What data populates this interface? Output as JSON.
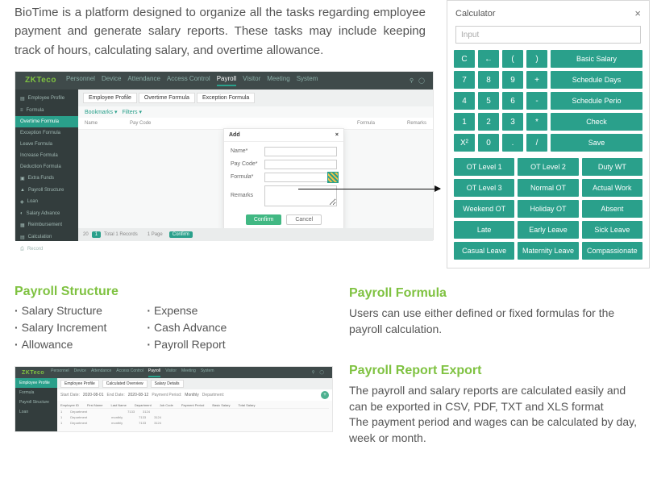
{
  "intro": "BioTime is a platform designed to organize all the tasks regarding employee payment and generate salary reports. These tasks may include keeping track of hours, calculating salary, and overtime allowance.",
  "ss1": {
    "logo": "ZKTeco",
    "nav": [
      "Personnel",
      "Device",
      "Attendance",
      "Access Control",
      "Payroll",
      "Visitor",
      "Meeting",
      "System"
    ],
    "nav_active": "Payroll",
    "tabs": [
      "Employee Profile",
      "Overtime Formula",
      "Exception Formula"
    ],
    "filters": [
      "Bookmarks ▾",
      "Filters ▾"
    ],
    "side": [
      "Employee Profile",
      "Formula",
      "Overtime Formula",
      "Exception Formula",
      "Leave Formula",
      "Increase Formula",
      "Deduction Formula",
      "Extra Funds",
      "Payroll Structure",
      "Loan",
      "Salary Advance",
      "Reimbursement",
      "Calculation",
      "Record"
    ],
    "side_active": "Overtime Formula",
    "cols": [
      "Name",
      "Pay Code",
      "Formula",
      "Remarks"
    ],
    "footer": {
      "pg": "1",
      "txt": "Total 1 Records",
      "page_lbl": "1 Page",
      "pg2": "Confirm"
    },
    "modal": {
      "title": "Add",
      "fields": {
        "name": "Name*",
        "paycode": "Pay Code*",
        "formula": "Formula*",
        "remarks": "Remarks"
      },
      "confirm": "Confirm",
      "cancel": "Cancel",
      "close": "×"
    }
  },
  "calc": {
    "title": "Calculator",
    "close": "×",
    "input_placeholder": "Input",
    "rows": [
      [
        "C",
        "←",
        "(",
        ")",
        "Basic Salary"
      ],
      [
        "7",
        "8",
        "9",
        "+",
        "Schedule Days"
      ],
      [
        "4",
        "5",
        "6",
        "-",
        "Schedule Perio"
      ],
      [
        "1",
        "2",
        "3",
        "*",
        "Check"
      ],
      [
        "X²",
        "0",
        ".",
        "/",
        "Save"
      ]
    ],
    "vars": [
      "OT Level 1",
      "OT Level 2",
      "Duty WT",
      "OT Level 3",
      "Normal OT",
      "Actual Work",
      "Weekend OT",
      "Holiday OT",
      "Absent",
      "Late",
      "Early Leave",
      "Sick Leave",
      "Casual Leave",
      "Maternity Leave",
      "Compassionate"
    ]
  },
  "payroll_structure": {
    "title": "Payroll Structure",
    "col1": [
      "Salary Structure",
      "Salary Increment",
      "Allowance"
    ],
    "col2": [
      "Expense",
      "Cash Advance",
      "Payroll Report"
    ]
  },
  "payroll_formula": {
    "title": "Payroll Formula",
    "text": "Users can use either defined or fixed formulas for the payroll calculation."
  },
  "report_export": {
    "title": "Payroll Report Export",
    "line1": "The payroll and salary reports are calculated easily and can be exported in CSV, PDF, TXT and XLS format",
    "line2": "The payment period and wages can be calculated by day, week or month."
  },
  "ss2": {
    "logo": "ZKTeco",
    "nav": [
      "Personnel",
      "Device",
      "Attendance",
      "Access Control",
      "Payroll",
      "Visitor",
      "Meeting",
      "System"
    ],
    "side": [
      "Employee Profile",
      "Formula",
      "Payroll Structure",
      "Loan"
    ],
    "side_active": "Employee Profile",
    "tabs": [
      "Employee Profile",
      "Calculated Overview",
      "Salary Details"
    ],
    "filter_labels": {
      "start": "Start Date:",
      "end": "End Date:",
      "period": "Payment Period:",
      "dep": "Department:"
    },
    "filter_vals": {
      "start": "2020-08-01",
      "end": "2020-08-12",
      "period": "Monthly"
    },
    "cols": [
      "Employee ID",
      "First Name",
      "Last Name",
      "Department",
      "Job Code",
      "Payment Period",
      "Basic Salary",
      "Total Salary"
    ],
    "rows": [
      [
        "1",
        "Department",
        "",
        "",
        "",
        "",
        "7133",
        "3124"
      ],
      [
        "1",
        "Department",
        "",
        "",
        "monthly",
        "",
        "7133",
        "3124"
      ],
      [
        "1",
        "Department",
        "",
        "",
        "monthly",
        "",
        "7133",
        "3124"
      ]
    ]
  }
}
